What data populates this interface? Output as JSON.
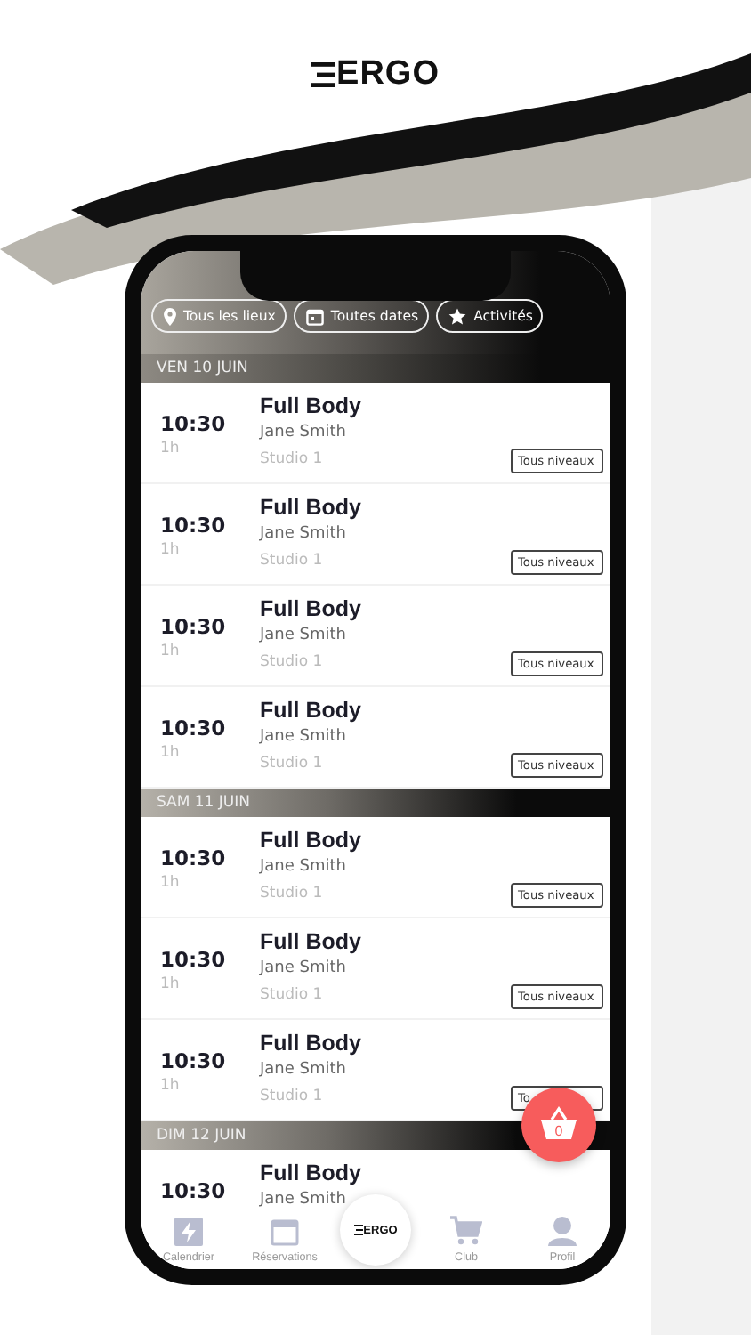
{
  "logo": {
    "text": "ERGO"
  },
  "filters": [
    {
      "kind": "place",
      "label": "Tous les lieux"
    },
    {
      "kind": "date",
      "label": "Toutes dates"
    },
    {
      "kind": "activity",
      "label": "Activités"
    }
  ],
  "days": [
    {
      "label": "VEN 10 JUIN",
      "sessions": [
        {
          "time": "10:30",
          "duration": "1h",
          "title": "Full Body",
          "coach": "Jane Smith",
          "room": "Studio 1",
          "level": "Tous niveaux"
        },
        {
          "time": "10:30",
          "duration": "1h",
          "title": "Full Body",
          "coach": "Jane Smith",
          "room": "Studio 1",
          "level": "Tous niveaux"
        },
        {
          "time": "10:30",
          "duration": "1h",
          "title": "Full Body",
          "coach": "Jane Smith",
          "room": "Studio 1",
          "level": "Tous niveaux"
        },
        {
          "time": "10:30",
          "duration": "1h",
          "title": "Full Body",
          "coach": "Jane Smith",
          "room": "Studio 1",
          "level": "Tous niveaux"
        }
      ]
    },
    {
      "label": "SAM 11 JUIN",
      "sessions": [
        {
          "time": "10:30",
          "duration": "1h",
          "title": "Full Body",
          "coach": "Jane Smith",
          "room": "Studio 1",
          "level": "Tous niveaux"
        },
        {
          "time": "10:30",
          "duration": "1h",
          "title": "Full Body",
          "coach": "Jane Smith",
          "room": "Studio 1",
          "level": "Tous niveaux"
        },
        {
          "time": "10:30",
          "duration": "1h",
          "title": "Full Body",
          "coach": "Jane Smith",
          "room": "Studio 1",
          "level": "To"
        }
      ]
    },
    {
      "label": "DIM 12 JUIN",
      "sessions": [
        {
          "time": "10:30",
          "title": "Full Body",
          "coach": "Jane Smith"
        }
      ]
    }
  ],
  "cart": {
    "count": "0"
  },
  "tab_bar": {
    "center_logo": "ERGO",
    "items": [
      {
        "kind": "calendar",
        "label": "Calendrier"
      },
      {
        "kind": "reservations",
        "label": "Réservations"
      },
      {
        "kind": "center"
      },
      {
        "kind": "shop",
        "label": "Club"
      },
      {
        "kind": "profile",
        "label": "Profil"
      }
    ]
  }
}
